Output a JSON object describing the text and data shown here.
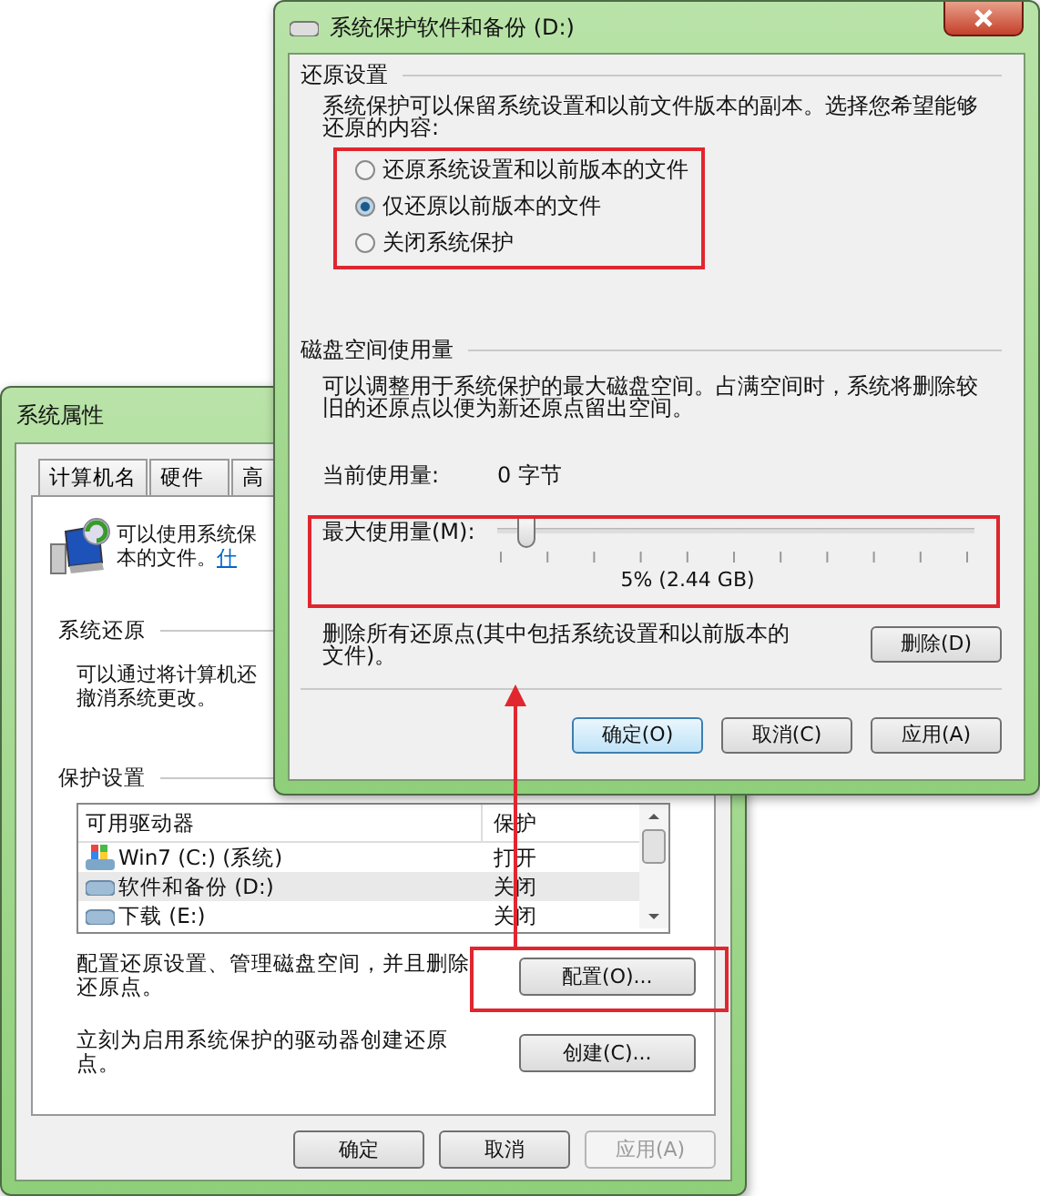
{
  "back_window": {
    "title": "系统属性",
    "tabs": [
      {
        "label": "计算机名",
        "selected": false
      },
      {
        "label": "硬件",
        "selected": false
      },
      {
        "label": "高",
        "selected": false
      }
    ],
    "intro": "可以使用系统保本的文件。",
    "intro_link": "什",
    "restore_heading": "系统还原",
    "restore_text": "可以通过将计算机还撤消系统更改。",
    "protection_heading": "保护设置",
    "drives_table": {
      "columns": [
        "可用驱动器",
        "保护"
      ],
      "rows": [
        {
          "kind": "system",
          "drive": "Win7 (C:) (系统)",
          "protection": "打开",
          "selected": false
        },
        {
          "kind": "drive",
          "drive": "软件和备份 (D:)",
          "protection": "关闭",
          "selected": true
        },
        {
          "kind": "drive",
          "drive": "下载 (E:)",
          "protection": "关闭",
          "selected": false
        }
      ]
    },
    "configure_text": "配置还原设置、管理磁盘空间，并且删除还原点。",
    "configure_button": "配置(O)...",
    "create_text": "立刻为启用系统保护的驱动器创建还原点。",
    "create_button": "创建(C)...",
    "buttons": [
      {
        "label": "确定",
        "disabled": false
      },
      {
        "label": "取消",
        "disabled": false
      },
      {
        "label": "应用(A)",
        "disabled": true
      }
    ]
  },
  "front_window": {
    "title": "系统保护软件和备份 (D:)",
    "restore_heading": "还原设置",
    "restore_text": "系统保护可以保留系统设置和以前文件版本的副本。选择您希望能够还原的内容:",
    "radios": [
      {
        "label": "还原系统设置和以前版本的文件",
        "selected": false
      },
      {
        "label": "仅还原以前版本的文件",
        "selected": true
      },
      {
        "label": "关闭系统保护",
        "selected": false
      }
    ],
    "disk_heading": "磁盘空间使用量",
    "disk_text": "可以调整用于系统保护的最大磁盘空间。占满空间时，系统将删除较旧的还原点以便为新还原点留出空间。",
    "current_label": "当前使用量:",
    "current_value": "0 字节",
    "max_slider": {
      "label": "最大使用量(M):",
      "level": 0.05,
      "reading": "5% (2.44 GB)"
    },
    "delete_text": "删除所有还原点(其中包括系统设置和以前版本的文件)。",
    "delete_button": "删除(D)",
    "buttons": [
      {
        "label": "确定(O)",
        "default": true
      },
      {
        "label": "取消(C)",
        "default": false
      },
      {
        "label": "应用(A)",
        "default": false
      }
    ]
  }
}
